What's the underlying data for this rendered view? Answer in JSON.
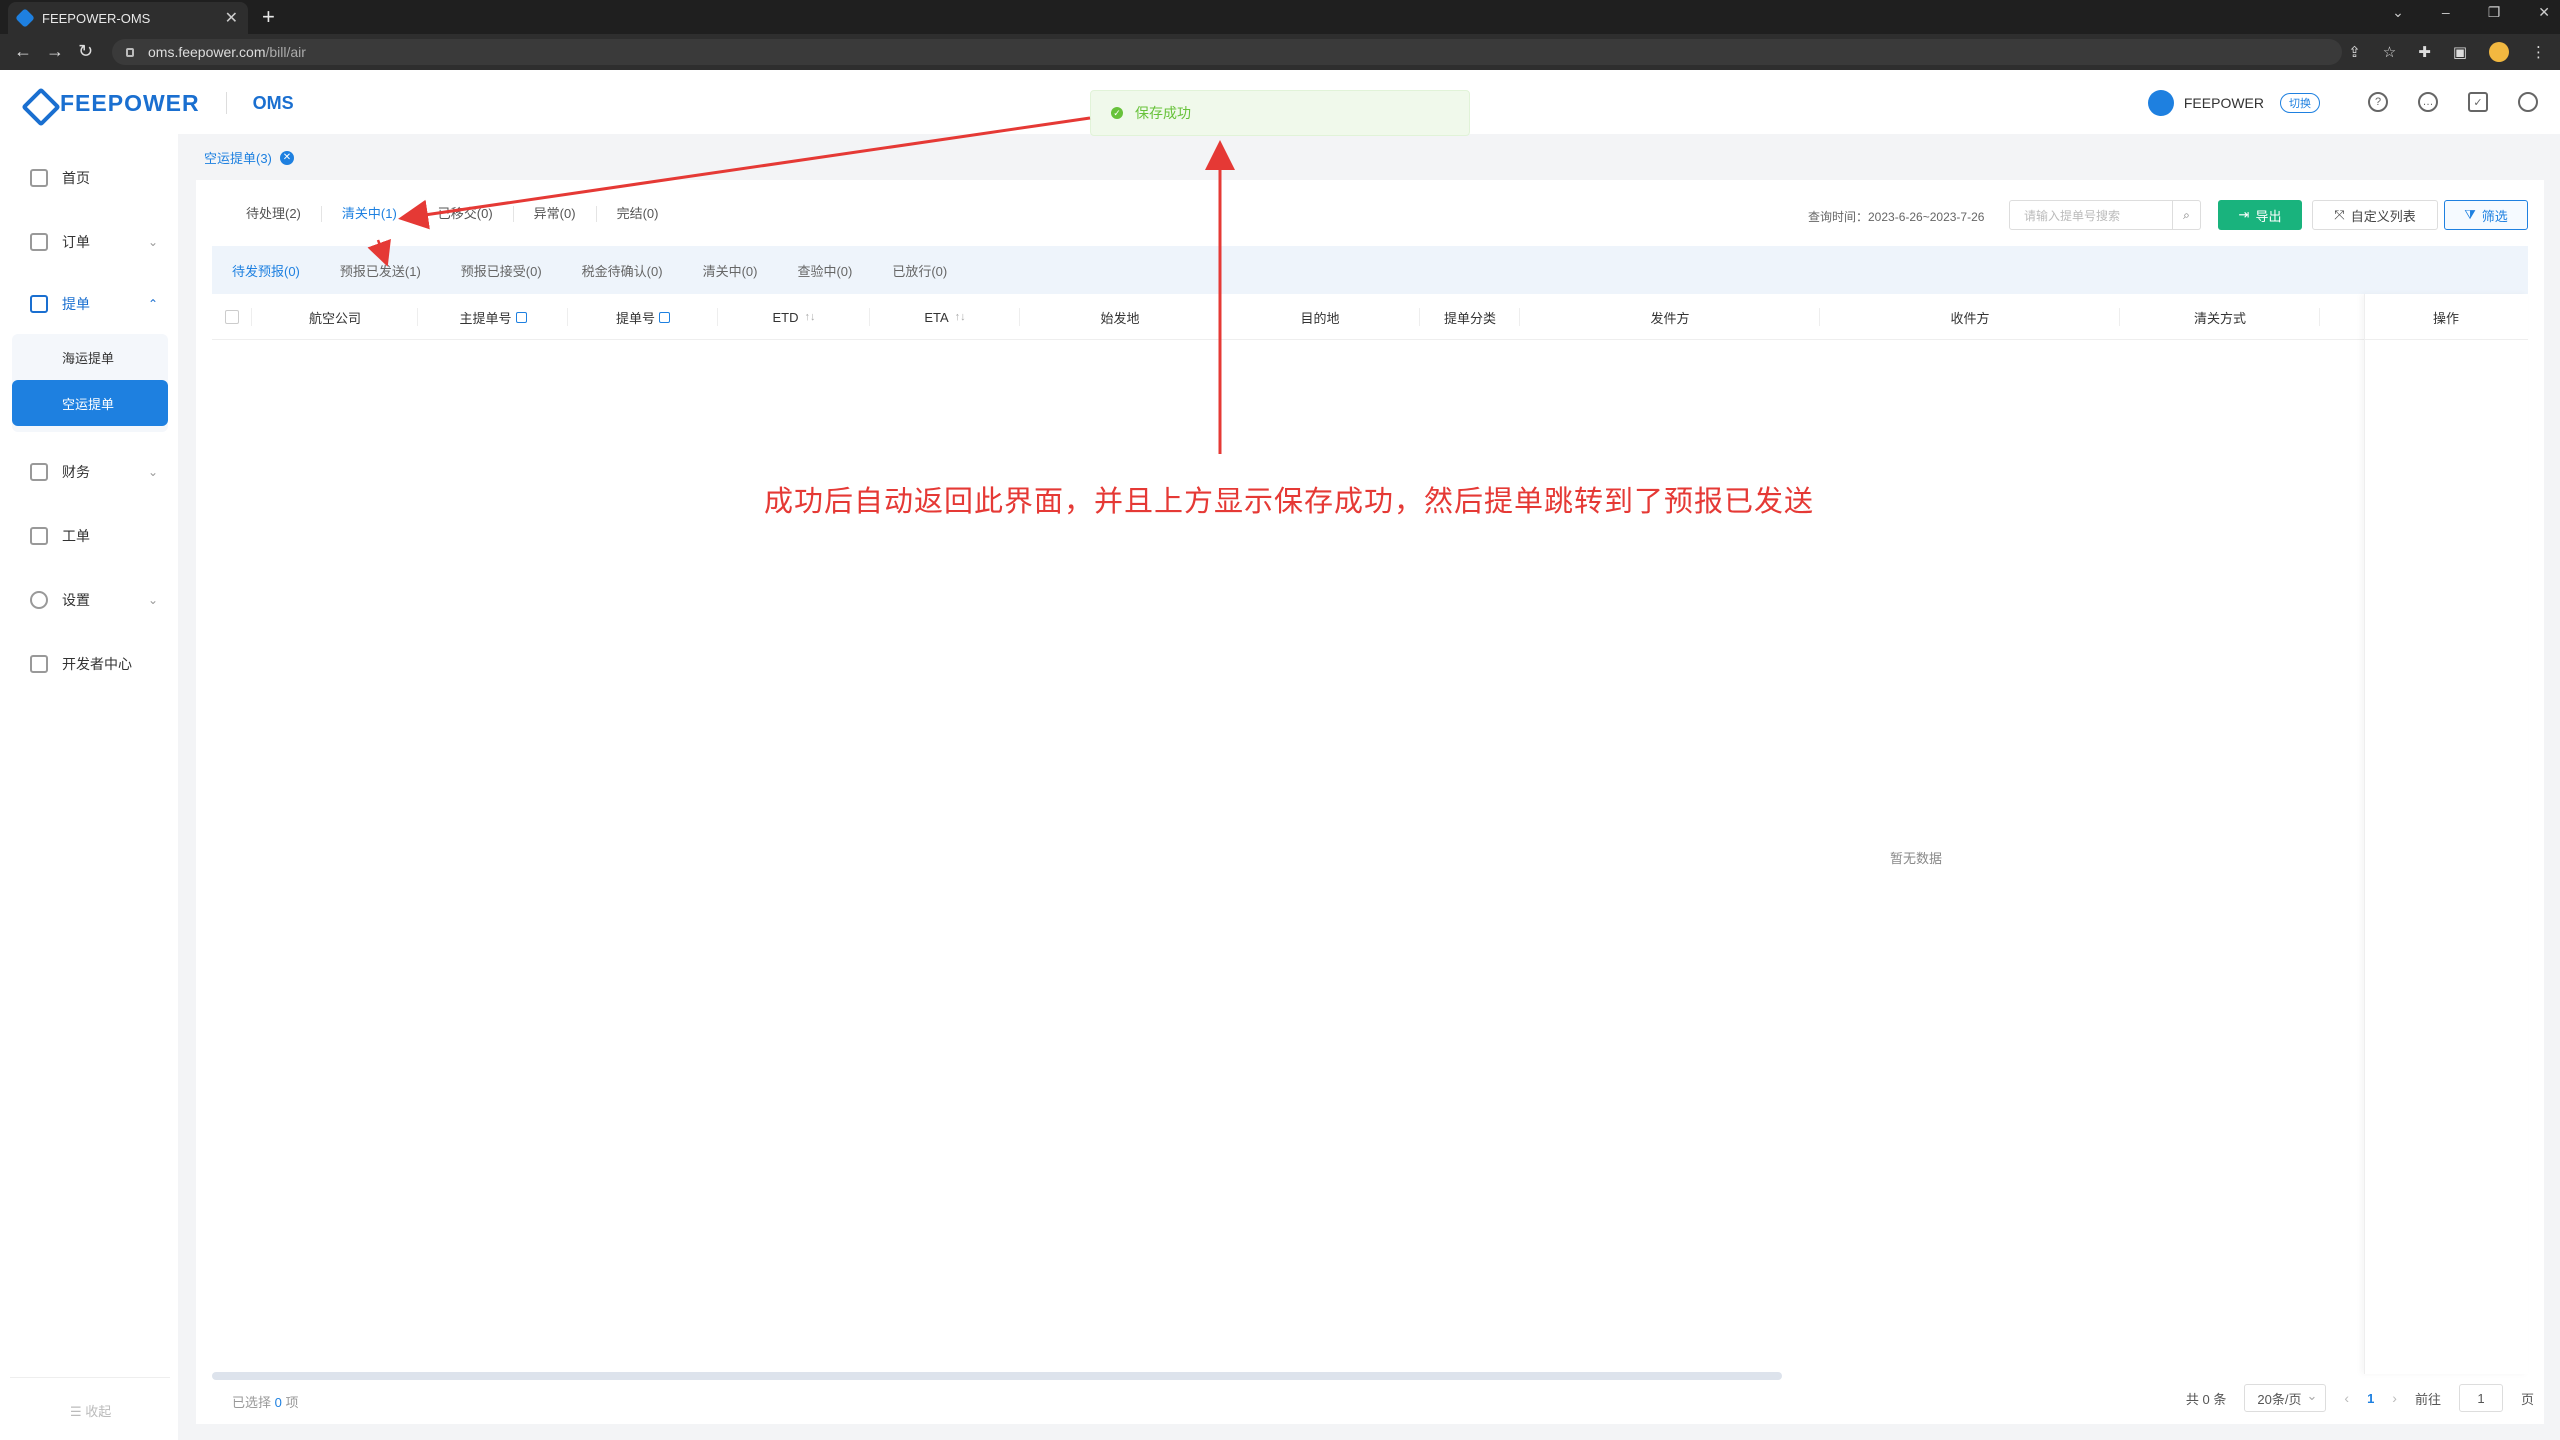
{
  "browser": {
    "tab_title": "FEEPOWER-OMS",
    "tab_close": "✕",
    "new_tab": "+",
    "url_host": "oms.feepower.com",
    "url_path": "/bill/air"
  },
  "header": {
    "logo_text": "FEEPOWER",
    "app_name": "OMS",
    "user_name": "FEEPOWER",
    "switch_label": "切换"
  },
  "toast": {
    "message": "保存成功"
  },
  "sidebar": {
    "home": "首页",
    "orders": "订单",
    "bills": "提单",
    "sea_bill": "海运提单",
    "air_bill": "空运提单",
    "finance": "财务",
    "ticket": "工单",
    "settings": "设置",
    "developer": "开发者中心",
    "collapse": "收起"
  },
  "page_tag": {
    "label": "空运提单(3)"
  },
  "status_tabs": [
    "待处理(2)",
    "清关中(1)",
    "已移交(0)",
    "异常(0)",
    "完结(0)"
  ],
  "toolbar": {
    "query_time": "查询时间：2023-6-26~2023-7-26",
    "search_placeholder": "请输入提单号搜索",
    "export": "导出",
    "custom_columns": "自定义列表",
    "filter": "筛选"
  },
  "sub_tabs": [
    "待发预报(0)",
    "预报已发送(1)",
    "预报已接受(0)",
    "税金待确认(0)",
    "清关中(0)",
    "查验中(0)",
    "已放行(0)"
  ],
  "columns": {
    "airline": "航空公司",
    "master_bill": "主提单号",
    "bill_no": "提单号",
    "etd": "ETD",
    "eta": "ETA",
    "origin": "始发地",
    "destination": "目的地",
    "bill_type": "提单分类",
    "shipper": "发件方",
    "consignee": "收件方",
    "clearance": "清关方式",
    "action": "操作"
  },
  "empty_text": "暂无数据",
  "footer": {
    "selected_prefix": "已选择",
    "selected_count": "0",
    "selected_suffix": "项",
    "total": "共 0 条",
    "page_size": "20条/页",
    "current_page": "1",
    "goto_label": "前往",
    "goto_value": "1",
    "goto_suffix": "页"
  },
  "annotation": {
    "text": "成功后自动返回此界面，并且上方显示保存成功，然后提单跳转到了预报已发送",
    "color": "#e53935"
  }
}
